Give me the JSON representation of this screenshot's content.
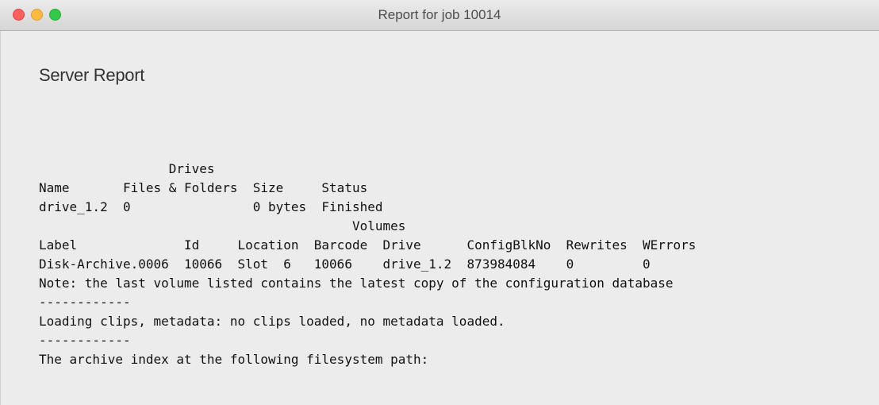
{
  "window": {
    "title": "Report for job 10014"
  },
  "report": {
    "heading": "Server Report",
    "lines": [
      "                 Drives",
      "Name       Files & Folders  Size     Status",
      "drive_1.2  0                0 bytes  Finished",
      "                                         Volumes",
      "Label              Id     Location  Barcode  Drive      ConfigBlkNo  Rewrites  WErrors",
      "Disk-Archive.0006  10066  Slot  6   10066    drive_1.2  873984084    0         0",
      "Note: the last volume listed contains the latest copy of the configuration database",
      "------------",
      "Loading clips, metadata: no clips loaded, no metadata loaded.",
      "------------",
      "The archive index at the following filesystem path:"
    ]
  }
}
